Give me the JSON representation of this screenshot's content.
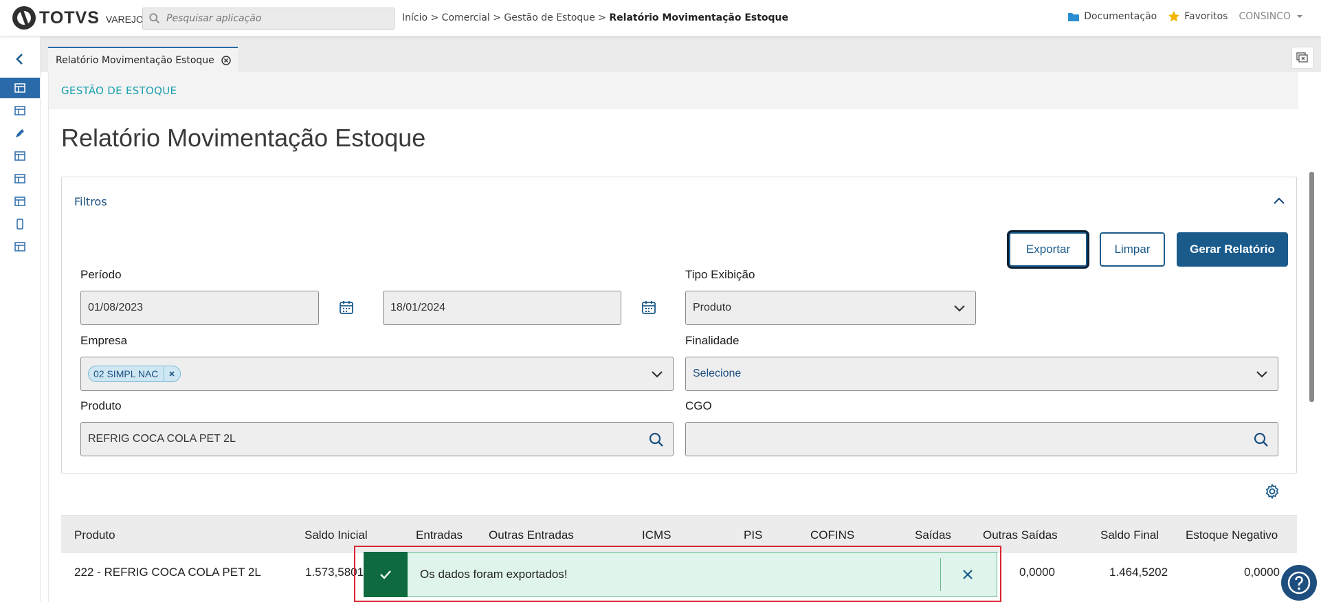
{
  "app": {
    "logo_text": "TOTVS",
    "logo_sub": "VAREJO"
  },
  "search": {
    "placeholder": "Pesquisar aplicação"
  },
  "breadcrumb": {
    "path": "Início > Comercial > Gestão de Estoque > ",
    "current": "Relatório Movimentação Estoque"
  },
  "topnav": {
    "docs": "Documentação",
    "favorites": "Favoritos",
    "user": "CONSINCO"
  },
  "tab": {
    "label": "Relatório Movimentação Estoque"
  },
  "module": {
    "title": "GESTÃO DE ESTOQUE"
  },
  "page": {
    "title": "Relatório Movimentação Estoque"
  },
  "filters": {
    "title": "Filtros",
    "buttons": {
      "export": "Exportar",
      "clear": "Limpar",
      "generate": "Gerar Relatório"
    },
    "period": {
      "label": "Período",
      "start": "01/08/2023",
      "end": "18/01/2024"
    },
    "display_type": {
      "label": "Tipo Exibição",
      "value": "Produto"
    },
    "company": {
      "label": "Empresa",
      "chip": "02 SIMPL NAC"
    },
    "purpose": {
      "label": "Finalidade",
      "value": "Selecione"
    },
    "product": {
      "label": "Produto",
      "value": "REFRIG COCA COLA PET 2L"
    },
    "cgo": {
      "label": "CGO",
      "value": ""
    }
  },
  "table": {
    "headers": [
      "Produto",
      "Saldo Inicial",
      "Entradas",
      "Outras Entradas",
      "ICMS",
      "PIS",
      "COFINS",
      "Saídas",
      "Outras Saídas",
      "Saldo Final",
      "Estoque Negativo"
    ],
    "rows": [
      {
        "produto": "222 - REFRIG COCA COLA PET 2L",
        "saldo_inicial": "1.573,5801",
        "outras_saidas": "0,0000",
        "saldo_final": "1.464,5202",
        "estoque_negativo": "0,0000"
      }
    ]
  },
  "toast": {
    "message": "Os dados foram exportados!"
  },
  "colors": {
    "primary": "#1a5b8c",
    "accent": "#1aa0b0",
    "success": "#0f6b3f",
    "toast_bg": "#dff4ea",
    "highlight": "#d9232e"
  }
}
